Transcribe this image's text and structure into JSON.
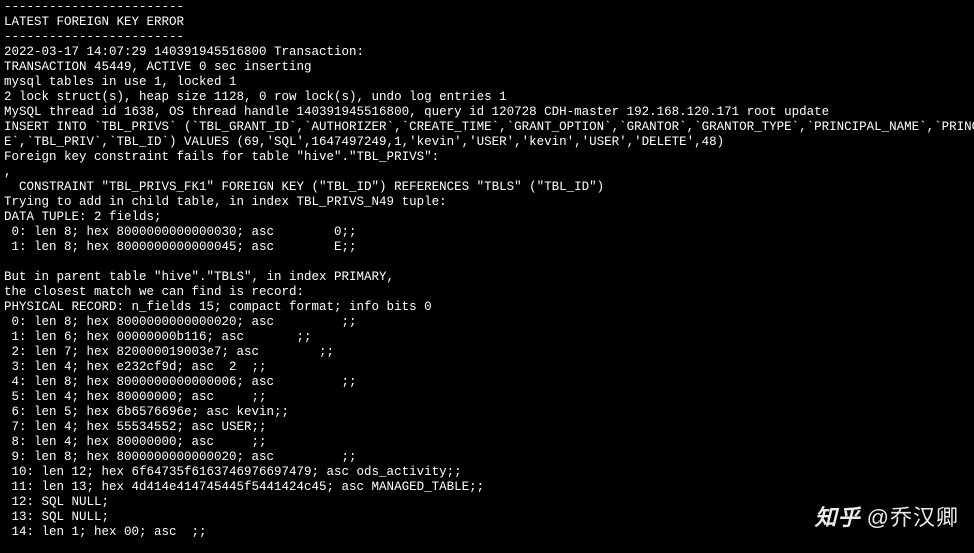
{
  "terminal": {
    "lines": [
      "------------------------",
      "LATEST FOREIGN KEY ERROR",
      "------------------------",
      "2022-03-17 14:07:29 140391945516800 Transaction:",
      "TRANSACTION 45449, ACTIVE 0 sec inserting",
      "mysql tables in use 1, locked 1",
      "2 lock struct(s), heap size 1128, 0 row lock(s), undo log entries 1",
      "MySQL thread id 1638, OS thread handle 140391945516800, query id 120728 CDH-master 192.168.120.171 root update",
      "INSERT INTO `TBL_PRIVS` (`TBL_GRANT_ID`,`AUTHORIZER`,`CREATE_TIME`,`GRANT_OPTION`,`GRANTOR`,`GRANTOR_TYPE`,`PRINCIPAL_NAME`,`PRINCIPAL_TYP",
      "E`,`TBL_PRIV`,`TBL_ID`) VALUES (69,'SQL',1647497249,1,'kevin','USER','kevin','USER','DELETE',48)",
      "Foreign key constraint fails for table \"hive\".\"TBL_PRIVS\":",
      ",",
      "  CONSTRAINT \"TBL_PRIVS_FK1\" FOREIGN KEY (\"TBL_ID\") REFERENCES \"TBLS\" (\"TBL_ID\")",
      "Trying to add in child table, in index TBL_PRIVS_N49 tuple:",
      "DATA TUPLE: 2 fields;",
      " 0: len 8; hex 8000000000000030; asc        0;;",
      " 1: len 8; hex 8000000000000045; asc        E;;",
      "",
      "But in parent table \"hive\".\"TBLS\", in index PRIMARY,",
      "the closest match we can find is record:",
      "PHYSICAL RECORD: n_fields 15; compact format; info bits 0",
      " 0: len 8; hex 8000000000000020; asc         ;;",
      " 1: len 6; hex 00000000b116; asc       ;;",
      " 2: len 7; hex 820000019003e7; asc        ;;",
      " 3: len 4; hex e232cf9d; asc  2  ;;",
      " 4: len 8; hex 8000000000000006; asc         ;;",
      " 5: len 4; hex 80000000; asc     ;;",
      " 6: len 5; hex 6b6576696e; asc kevin;;",
      " 7: len 4; hex 55534552; asc USER;;",
      " 8: len 4; hex 80000000; asc     ;;",
      " 9: len 8; hex 8000000000000020; asc         ;;",
      " 10: len 12; hex 6f64735f6163746976697479; asc ods_activity;;",
      " 11: len 13; hex 4d414e414745445f5441424c45; asc MANAGED_TABLE;;",
      " 12: SQL NULL;",
      " 13: SQL NULL;",
      " 14: len 1; hex 00; asc  ;;"
    ]
  },
  "watermark": {
    "logo": "知乎",
    "author": "@乔汉卿"
  }
}
